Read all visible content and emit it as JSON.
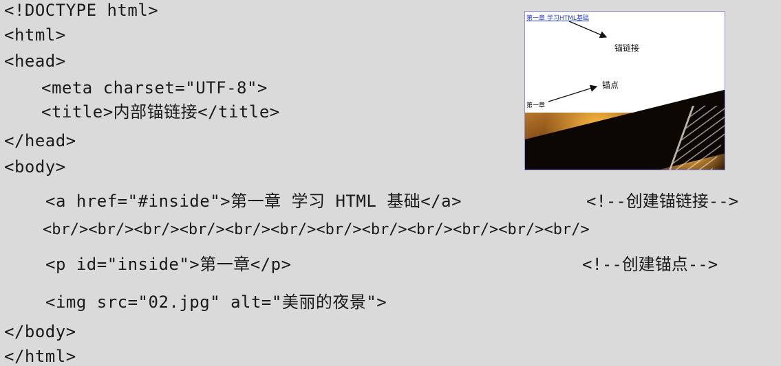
{
  "code": {
    "line1": "<!DOCTYPE html>",
    "line2": "<html>",
    "line3": "<head>",
    "line4": "<meta charset=\"UTF-8\">",
    "line5": "<title>内部锚链接</title>",
    "line6": "</head>",
    "line7": "<body>",
    "line8": "<a href=\"#inside\">第一章 学习 HTML 基础</a>",
    "line8_comment": "<!--创建锚链接-->",
    "line9": "<br/><br/><br/><br/><br/><br/><br/><br/><br/><br/><br/><br/>",
    "line10": "<p id=\"inside\">第一章</p>",
    "line10_comment": "<!--创建锚点-->",
    "line11": "<img src=\"02.jpg\" alt=\"美丽的夜景\">",
    "line12": "</body>",
    "line13": "</html>"
  },
  "preview": {
    "link_text": "第一章 学习HTML基础",
    "anchor_link_label": "锚链接",
    "anchor_label": "锚点",
    "chapter_text": "第一章"
  }
}
